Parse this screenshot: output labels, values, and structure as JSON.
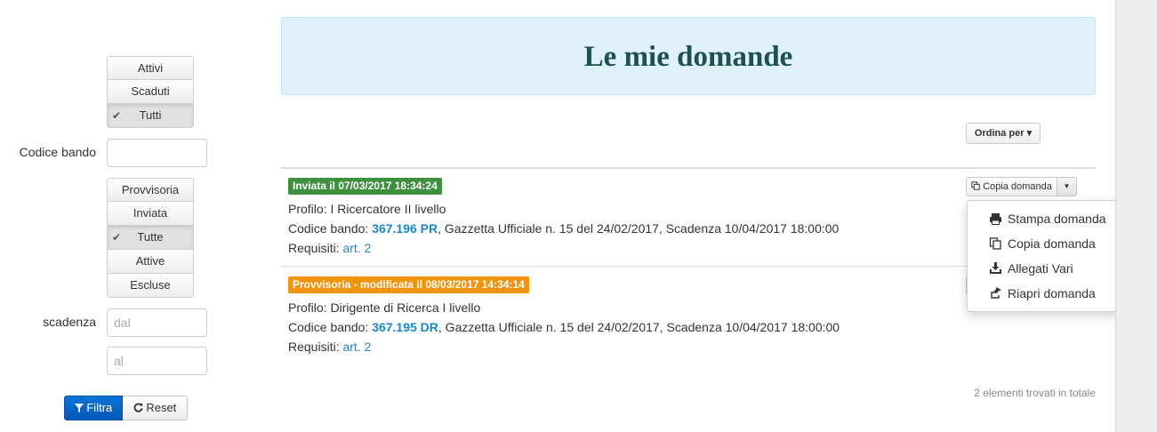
{
  "sidebar": {
    "status_filter": [
      {
        "label": "Attivi",
        "active": false
      },
      {
        "label": "Scaduti",
        "active": false
      },
      {
        "label": "Tutti",
        "active": true
      }
    ],
    "codice_bando_label": "Codice bando",
    "codice_bando_value": "",
    "tipo_filter": [
      {
        "label": "Provvisoria",
        "active": false
      },
      {
        "label": "Inviata",
        "active": false
      },
      {
        "label": "Tutte",
        "active": true
      },
      {
        "label": "Attive",
        "active": false
      },
      {
        "label": "Escluse",
        "active": false
      }
    ],
    "scadenza_label": "scadenza",
    "dal_placeholder": "dal",
    "al_placeholder": "al",
    "filtra_label": "Filtra",
    "reset_label": "Reset"
  },
  "main": {
    "title": "Le mie domande",
    "sort_label": "Ordina per",
    "items": [
      {
        "badge": "Inviata il 07/03/2017 18:34:24",
        "badge_color": "#3e8f3e",
        "profilo_label": "Profilo:",
        "profilo": "I Ricercatore II livello",
        "codice_label": "Codice bando:",
        "codice": "367.196 PR",
        "codice_rest": ", Gazzetta Ufficiale n. 15 del 24/02/2017, Scadenza 10/04/2017 18:00:00",
        "requisiti_label": "Requisiti:",
        "requisiti_link": "art. 2"
      },
      {
        "badge": "Provvisoria - modificata il 08/03/2017 14:34:14",
        "badge_color": "#f0940c",
        "profilo_label": "Profilo:",
        "profilo": "Dirigente di Ricerca I livello",
        "codice_label": "Codice bando:",
        "codice": "367.195 DR",
        "codice_rest": ", Gazzetta Ufficiale n. 15 del 24/02/2017, Scadenza 10/04/2017 18:00:00",
        "requisiti_label": "Requisiti:",
        "requisiti_link": "art. 2"
      }
    ],
    "copy_button_label": "Copia domanda",
    "dropdown": [
      {
        "label": "Stampa domanda",
        "icon": "print-icon"
      },
      {
        "label": "Copia domanda",
        "icon": "copy-icon"
      },
      {
        "label": "Allegati Vari",
        "icon": "download-icon"
      },
      {
        "label": "Riapri domanda",
        "icon": "share-icon"
      }
    ],
    "total_text": "2 elementi trovati in totale"
  },
  "colors": {
    "title_bg": "#dff1fb",
    "title_text": "#1f4f4f",
    "link": "#1a87c8",
    "primary_button": "#0a74d6"
  }
}
